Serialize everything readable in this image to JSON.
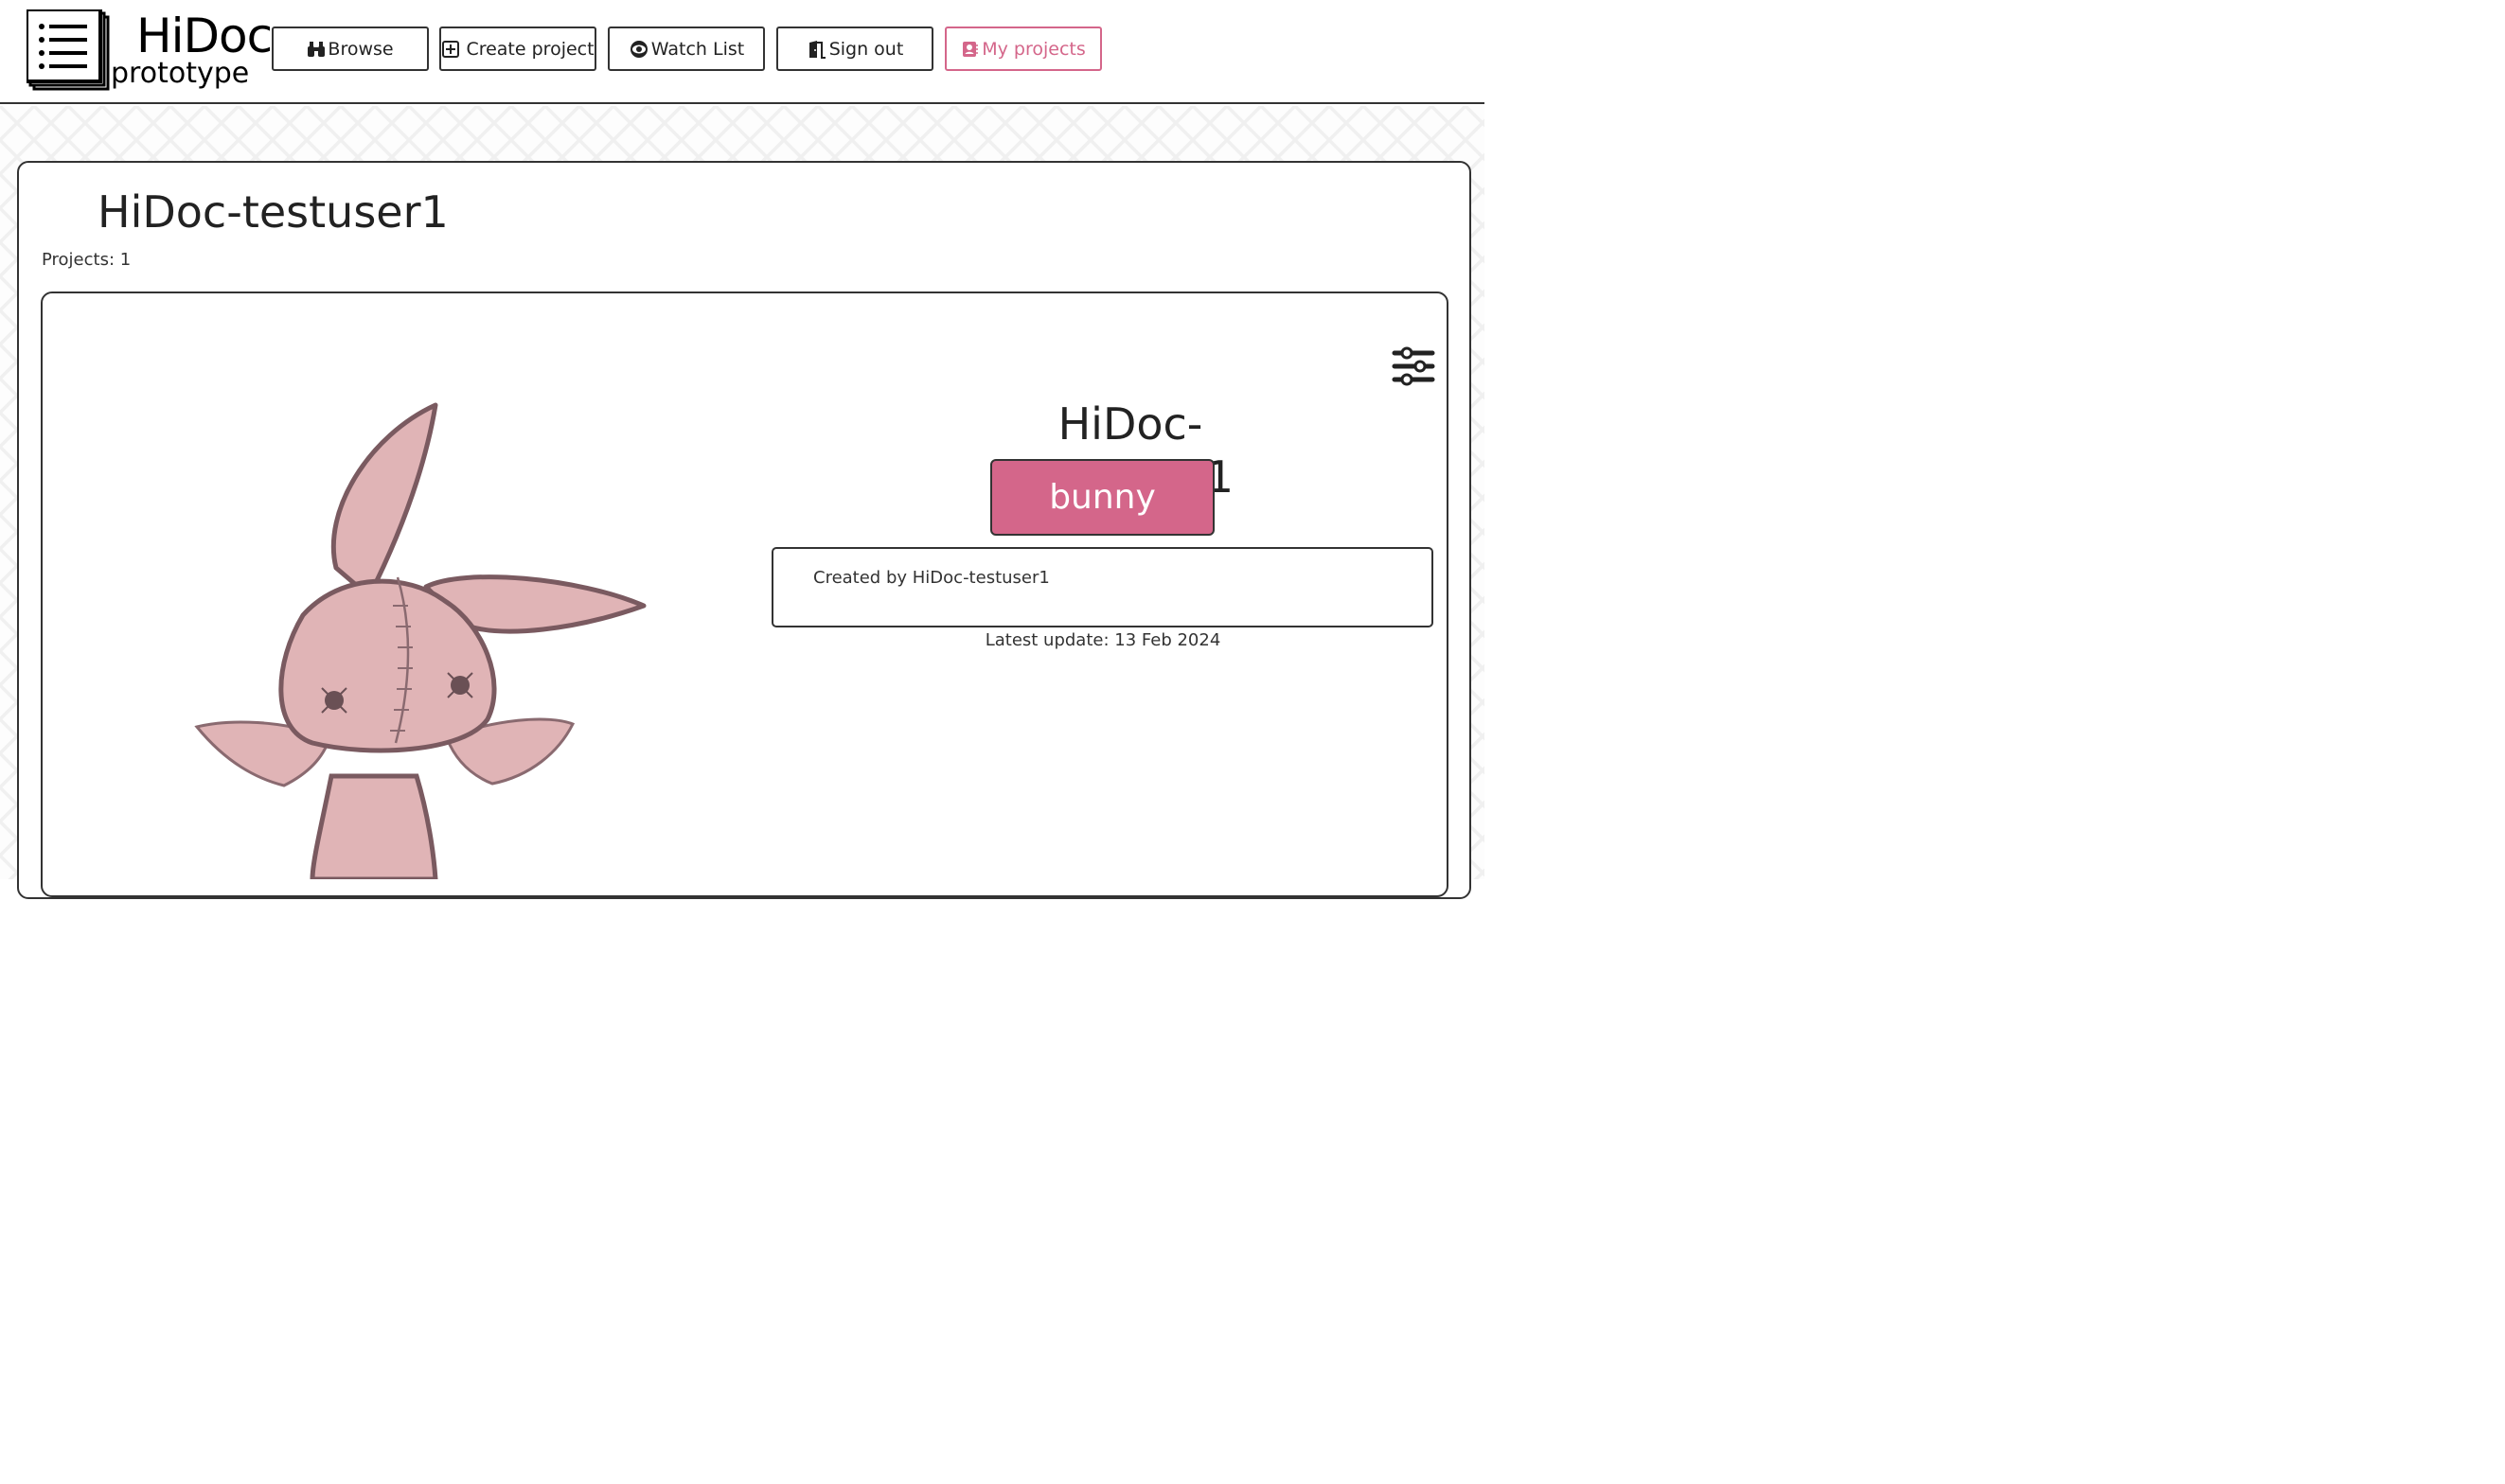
{
  "header": {
    "logo_title": "HiDoc",
    "logo_subtitle": "prototype",
    "nav": [
      {
        "label": "Browse",
        "icon": "binoculars-icon"
      },
      {
        "label": "Create project",
        "icon": "plus-square-icon"
      },
      {
        "label": "Watch List",
        "icon": "eye-icon"
      },
      {
        "label": "Sign out",
        "icon": "door-exit-icon"
      },
      {
        "label": "My projects",
        "icon": "user-contact-icon",
        "active": true
      }
    ]
  },
  "main": {
    "title": "HiDoc-testuser1",
    "projects_count": "Projects: 1",
    "project": {
      "title": "HiDoc-testuser1",
      "tag": "bunny",
      "description": "Created by HiDoc-testuser1",
      "latest_update": "Latest update: 13 Feb 2024"
    }
  },
  "colors": {
    "accent": "#d4668a",
    "border": "#333333",
    "bunny_fill": "#e0b4b6",
    "bunny_outline": "#7a5a60"
  }
}
